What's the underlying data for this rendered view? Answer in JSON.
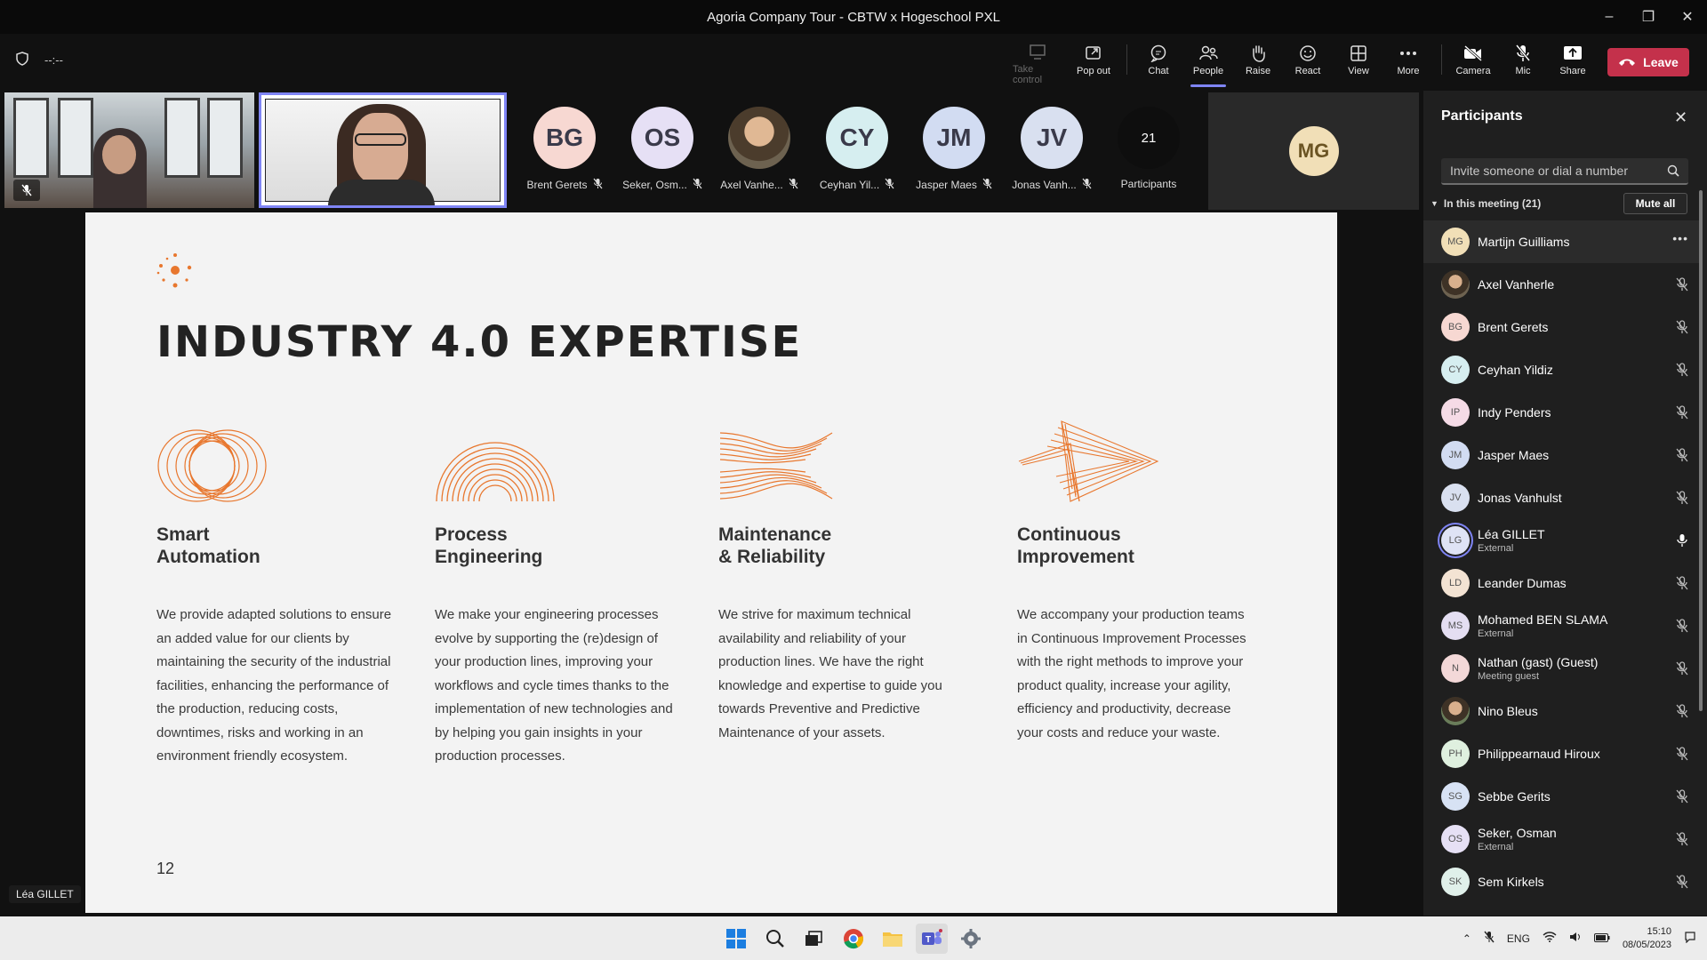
{
  "window": {
    "title": "Agoria Company Tour - CBTW x Hogeschool PXL",
    "controls": [
      "minimize",
      "restore",
      "close"
    ]
  },
  "toolbar": {
    "timer": "--:--",
    "buttons": [
      {
        "label": "Take control",
        "icon": "take-control-icon",
        "state": "disabled"
      },
      {
        "label": "Pop out",
        "icon": "pop-out-icon"
      },
      {
        "label": "Chat",
        "icon": "chat-icon"
      },
      {
        "label": "People",
        "icon": "people-icon",
        "state": "active"
      },
      {
        "label": "Raise",
        "icon": "raise-hand-icon"
      },
      {
        "label": "React",
        "icon": "react-icon"
      },
      {
        "label": "View",
        "icon": "view-icon"
      },
      {
        "label": "More",
        "icon": "more-icon"
      },
      {
        "label": "Camera",
        "icon": "camera-off-icon"
      },
      {
        "label": "Mic",
        "icon": "mic-off-icon"
      },
      {
        "label": "Share",
        "icon": "share-icon"
      }
    ],
    "leave_label": "Leave"
  },
  "strip": {
    "tiles": [
      {
        "initials": "BG",
        "name": "Brent Gerets",
        "color": "#f7d8d2",
        "muted": true
      },
      {
        "initials": "OS",
        "name": "Seker, Osm...",
        "color": "#e6e0f5",
        "muted": true
      },
      {
        "initials": "",
        "name": "Axel Vanhe...",
        "color": "#6d6250",
        "muted": true,
        "photo": true
      },
      {
        "initials": "CY",
        "name": "Ceyhan Yil...",
        "color": "#d6eef0",
        "muted": true
      },
      {
        "initials": "JM",
        "name": "Jasper Maes",
        "color": "#d2dcf2",
        "muted": true
      },
      {
        "initials": "JV",
        "name": "Jonas Vanh...",
        "color": "#d9e0f0",
        "muted": true
      }
    ],
    "participants_count": "21",
    "participants_label": "Participants",
    "big_tile_initials": "MG"
  },
  "slide": {
    "title": "INDUSTRY 4.0 EXPERTISE",
    "page_number": "12",
    "columns": [
      {
        "heading": "Smart\nAutomation",
        "body": "We provide adapted solutions to ensure an added value for our clients by maintaining the security of the industrial facilities, enhancing the performance of the production, reducing costs, downtimes, risks and working in an environment friendly ecosystem."
      },
      {
        "heading": "Process\nEngineering",
        "body": "We make your engineering processes evolve by supporting the (re)design of your production lines, improving your workflows and cycle times thanks to the implementation of new technologies and by helping you gain insights in your production processes."
      },
      {
        "heading": "Maintenance\n& Reliability",
        "body": "We strive for maximum technical availability and reliability of your production lines. We have the right knowledge and expertise to guide you towards Preventive and Predictive Maintenance of your assets."
      },
      {
        "heading": "Continuous\nImprovement",
        "body": "We accompany your production teams in Continuous Improvement Processes with the right methods to improve your product quality, increase your agility, efficiency and productivity, decrease your costs and reduce your waste."
      }
    ],
    "accent_color": "#e8772e"
  },
  "presenter_chip": "Léa GILLET",
  "panel": {
    "title": "Participants",
    "invite_placeholder": "Invite someone or dial a number",
    "in_meeting_label": "In this meeting (21)",
    "mute_all_label": "Mute all",
    "participants": [
      {
        "initials": "MG",
        "name": "Martijn Guilliams",
        "sub": "",
        "color": "#f1dfb7",
        "mic": "more"
      },
      {
        "initials": "",
        "name": "Axel Vanherle",
        "sub": "",
        "color": "#6d6250",
        "mic": "muted",
        "photo": true
      },
      {
        "initials": "BG",
        "name": "Brent Gerets",
        "sub": "",
        "color": "#f7d8d2",
        "mic": "muted"
      },
      {
        "initials": "CY",
        "name": "Ceyhan Yildiz",
        "sub": "",
        "color": "#d6eef0",
        "mic": "muted"
      },
      {
        "initials": "IP",
        "name": "Indy Penders",
        "sub": "",
        "color": "#f5dbe6",
        "mic": "muted"
      },
      {
        "initials": "JM",
        "name": "Jasper Maes",
        "sub": "",
        "color": "#d2dcf2",
        "mic": "muted"
      },
      {
        "initials": "JV",
        "name": "Jonas Vanhulst",
        "sub": "",
        "color": "#d9e0f0",
        "mic": "muted"
      },
      {
        "initials": "LG",
        "name": "Léa GILLET",
        "sub": "External",
        "color": "#dfe3f5",
        "mic": "on",
        "ring": true
      },
      {
        "initials": "LD",
        "name": "Leander Dumas",
        "sub": "",
        "color": "#f3e3d3",
        "mic": "muted"
      },
      {
        "initials": "MS",
        "name": "Mohamed BEN SLAMA",
        "sub": "External",
        "color": "#e4def2",
        "mic": "muted"
      },
      {
        "initials": "N",
        "name": "Nathan (gast) (Guest)",
        "sub": "Meeting guest",
        "color": "#f3d8d8",
        "mic": "muted"
      },
      {
        "initials": "",
        "name": "Nino Bleus",
        "sub": "",
        "color": "#6a7d5a",
        "mic": "muted",
        "photo": true
      },
      {
        "initials": "PH",
        "name": "Philippearnaud Hiroux",
        "sub": "",
        "color": "#dff0df",
        "mic": "muted"
      },
      {
        "initials": "SG",
        "name": "Sebbe Gerits",
        "sub": "",
        "color": "#d7e2f4",
        "mic": "muted"
      },
      {
        "initials": "OS",
        "name": "Seker, Osman",
        "sub": "External",
        "color": "#e6e0f5",
        "mic": "muted"
      },
      {
        "initials": "SK",
        "name": "Sem Kirkels",
        "sub": "",
        "color": "#e0f0ea",
        "mic": "muted"
      }
    ]
  },
  "taskbar": {
    "apps": [
      "start-icon",
      "search-icon",
      "task-view-icon",
      "chrome-icon",
      "file-explorer-icon",
      "teams-icon",
      "settings-icon"
    ],
    "language": "ENG",
    "time": "15:10",
    "date": "08/05/2023"
  }
}
